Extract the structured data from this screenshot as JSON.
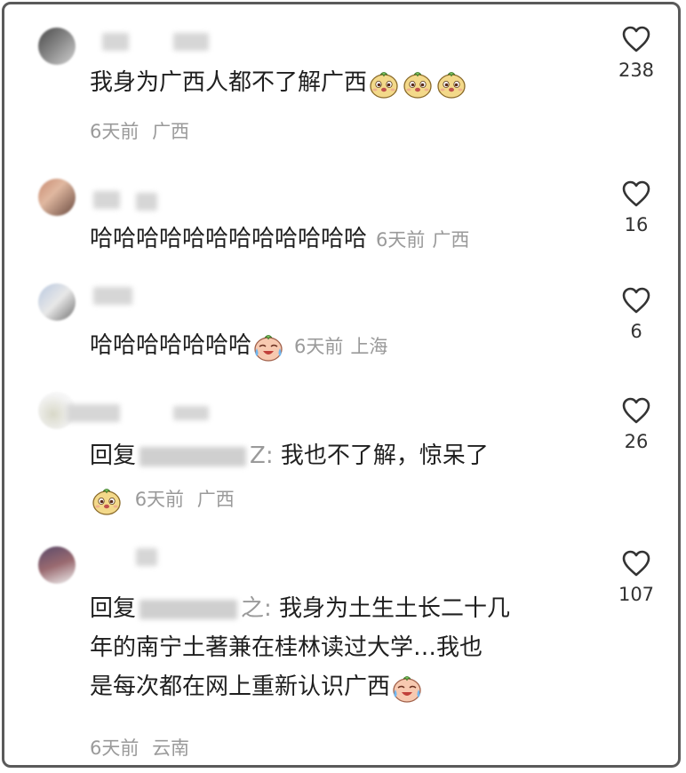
{
  "comments": [
    {
      "text": "我身为广西人都不了解广西",
      "time": "6天前",
      "location": "广西",
      "likes": "238"
    },
    {
      "text": "哈哈哈哈哈哈哈哈哈哈哈哈",
      "time": "6天前",
      "location": "广西",
      "likes": "16"
    },
    {
      "text": "哈哈哈哈哈哈哈",
      "time": "6天前",
      "location": "上海",
      "likes": "6"
    },
    {
      "reply_prefix": "回复",
      "reply_target_tail": "Z:",
      "text": "我也不了解，惊呆了",
      "time": "6天前",
      "location": "广西",
      "likes": "26"
    },
    {
      "reply_prefix": "回复",
      "reply_target_tail": "之:",
      "text_line1": "我身为土生土长二十几",
      "text_line2": "年的南宁土著兼在桂林读过大学…我也",
      "text_line3": "是每次都在网上重新认识广西",
      "time": "6天前",
      "location": "云南",
      "likes": "107"
    }
  ],
  "colors": {
    "text": "#1f1f1f",
    "meta": "#9a9a9a",
    "border": "#5a5a5a",
    "heart": "#333333"
  },
  "icons": {
    "like": "heart-outline-icon",
    "emoji_cute": "doge-bun-emoji",
    "emoji_cry": "laugh-cry-emoji"
  }
}
